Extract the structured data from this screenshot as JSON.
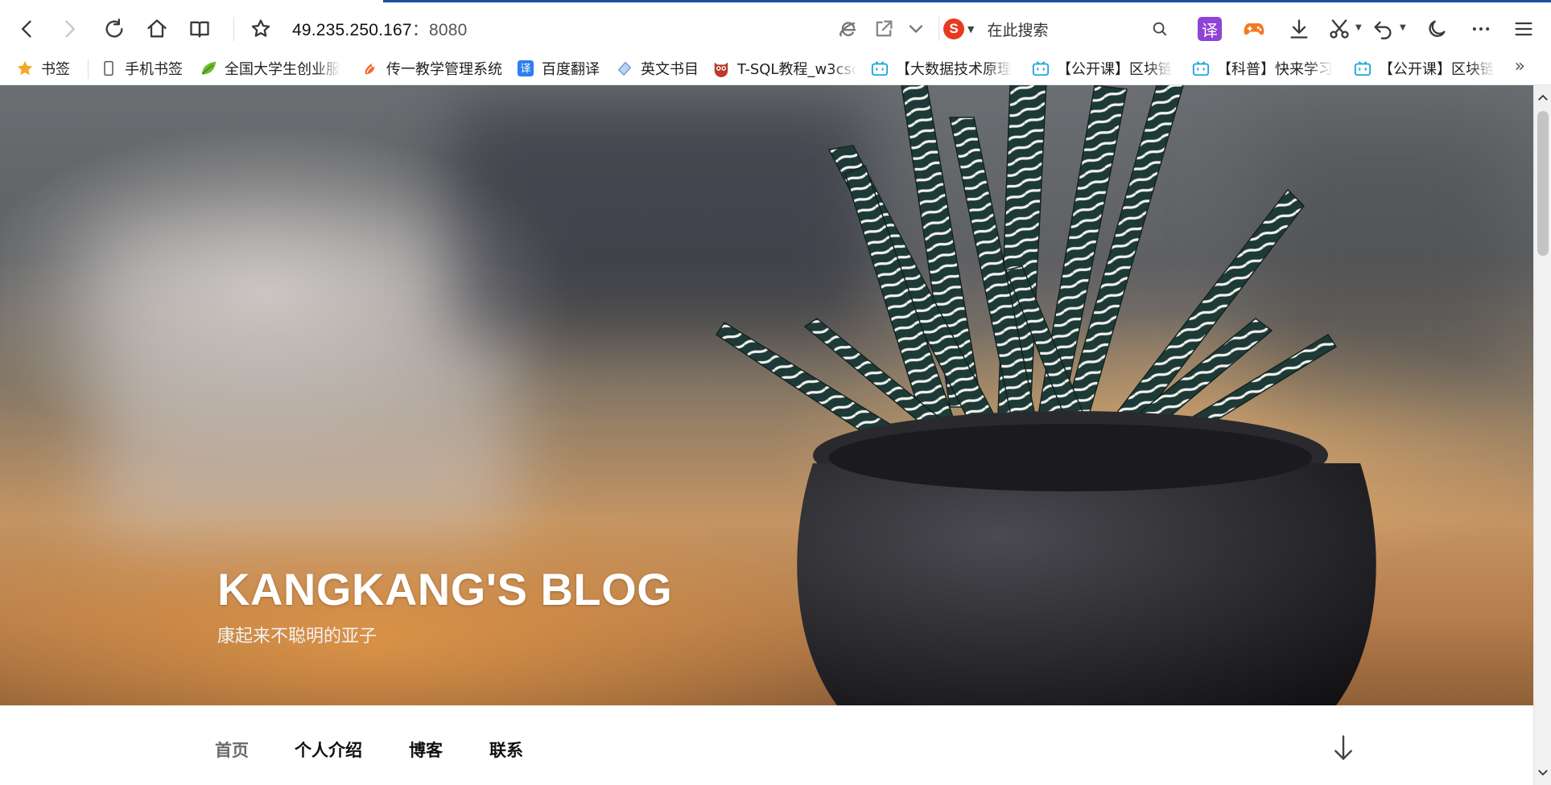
{
  "browser": {
    "url_host": "49.235.250.167",
    "url_port": "8080",
    "url_separator": "：",
    "search_placeholder": "在此搜索",
    "search_engine_logo": "S",
    "translate_label": "译",
    "accent_color": "#1f4e9c"
  },
  "bookmarks": [
    {
      "label": "书签",
      "icon": "star-icon"
    },
    {
      "label": "手机书签",
      "icon": "phone-icon"
    },
    {
      "label": "全国大学生创业服",
      "icon": "leaf-icon"
    },
    {
      "label": "传一教学管理系统",
      "icon": "flame-icon"
    },
    {
      "label": "百度翻译",
      "icon": "translate-icon"
    },
    {
      "label": "英文书目",
      "icon": "diamond-icon"
    },
    {
      "label": "T-SQL教程_w3csc",
      "icon": "owl-icon"
    },
    {
      "label": "【大数据技术原理",
      "icon": "bilibili-icon"
    },
    {
      "label": "【公开课】区块链",
      "icon": "bilibili-icon"
    },
    {
      "label": "【科普】快来学习",
      "icon": "bilibili-icon"
    },
    {
      "label": "【公开课】区块链",
      "icon": "bilibili-icon"
    }
  ],
  "bookmarks_more": "»",
  "hero": {
    "title": "KANGKANG'S BLOG",
    "subtitle": "康起来不聪明的亚子"
  },
  "nav": {
    "items": [
      {
        "label": "首页",
        "active": true
      },
      {
        "label": "个人介绍",
        "active": false
      },
      {
        "label": "博客",
        "active": false
      },
      {
        "label": "联系",
        "active": false
      }
    ]
  }
}
